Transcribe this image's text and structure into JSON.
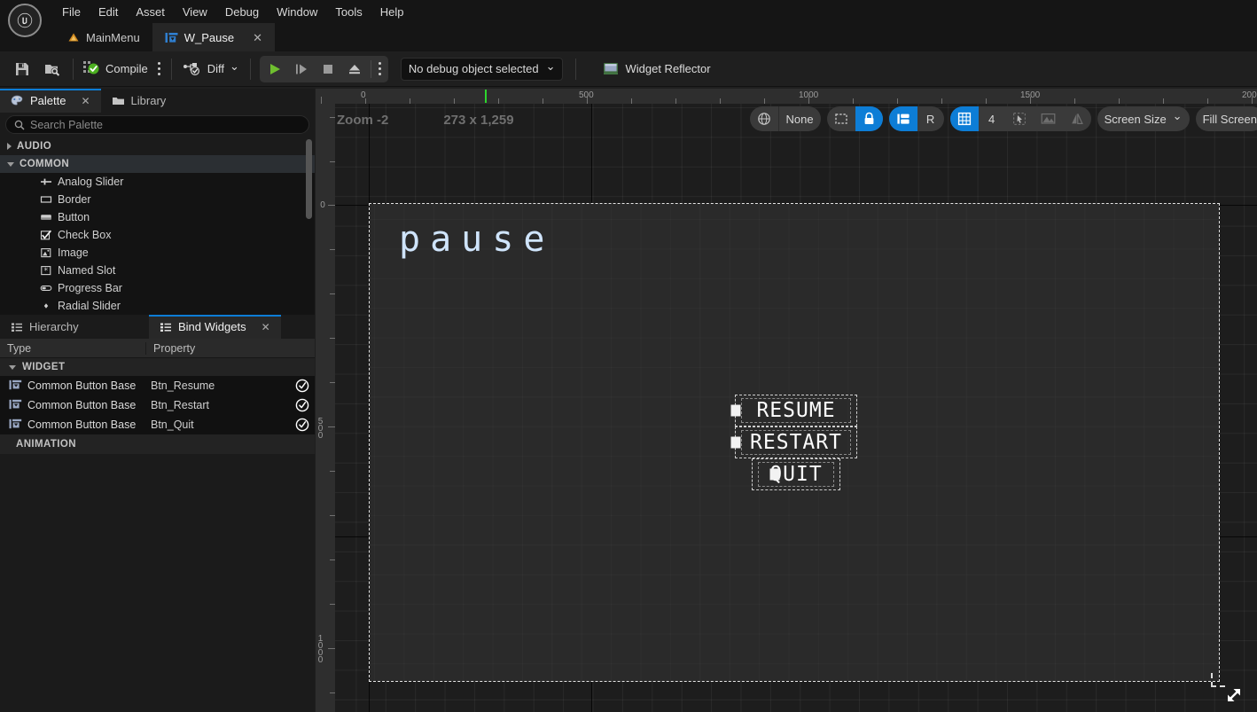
{
  "app": {
    "logo_glyph": "U"
  },
  "menu": {
    "items": [
      {
        "label": "File"
      },
      {
        "label": "Edit"
      },
      {
        "label": "Asset"
      },
      {
        "label": "View"
      },
      {
        "label": "Debug"
      },
      {
        "label": "Window"
      },
      {
        "label": "Tools"
      },
      {
        "label": "Help"
      }
    ]
  },
  "tabs": {
    "items": [
      {
        "label": "MainMenu",
        "icon": "blueprint-icon",
        "active": false,
        "closable": false
      },
      {
        "label": "W_Pause",
        "icon": "widget-blueprint-icon",
        "active": true,
        "closable": true,
        "close": "✕"
      }
    ]
  },
  "toolbar": {
    "save_icon": "save-icon",
    "browse_icon": "browse-content-icon",
    "compile_label": "Compile",
    "compile_icon": "compile-icon",
    "compile_kebab": "compile-options-icon",
    "diff_label": "Diff",
    "diff_icon": "diff-icon",
    "diff_caret": "⌄",
    "play_icon": "play-icon",
    "step_icon": "step-icon",
    "stop_icon": "stop-icon",
    "eject_icon": "eject-icon",
    "play_kebab": "play-options-icon",
    "debug_object": "No debug object selected",
    "debug_caret": "⌄",
    "widget_reflector_label": "Widget Reflector",
    "widget_reflector_icon": "widget-reflector-icon"
  },
  "palette": {
    "tabs": [
      {
        "label": "Palette",
        "icon": "palette-icon",
        "active": true,
        "close": "✕"
      },
      {
        "label": "Library",
        "icon": "library-folder-icon",
        "active": false
      }
    ],
    "search": {
      "placeholder": "Search Palette",
      "value": "",
      "icon": "search-icon"
    },
    "categories": [
      {
        "label": "AUDIO",
        "expanded": false
      },
      {
        "label": "COMMON",
        "expanded": true
      }
    ],
    "items": [
      {
        "label": "Analog Slider",
        "icon": "analog-slider-icon"
      },
      {
        "label": "Border",
        "icon": "border-icon"
      },
      {
        "label": "Button",
        "icon": "button-icon"
      },
      {
        "label": "Check Box",
        "icon": "check-box-icon"
      },
      {
        "label": "Image",
        "icon": "image-icon"
      },
      {
        "label": "Named Slot",
        "icon": "named-slot-icon"
      },
      {
        "label": "Progress Bar",
        "icon": "progress-bar-icon"
      },
      {
        "label": "Radial Slider",
        "icon": "radial-slider-icon"
      }
    ]
  },
  "bind_widgets": {
    "tabs": [
      {
        "label": "Hierarchy",
        "icon": "hierarchy-icon",
        "active": false
      },
      {
        "label": "Bind Widgets",
        "icon": "bind-widgets-icon",
        "active": true,
        "close": "✕"
      }
    ],
    "columns": [
      {
        "label": "Type"
      },
      {
        "label": "Property"
      },
      {
        "label": ""
      }
    ],
    "group_widget": "WIDGET",
    "group_animation": "ANIMATION",
    "rows": [
      {
        "type": "Common Button Base",
        "property": "Btn_Resume",
        "icon": "common-button-base-icon",
        "status": "bound-check-icon"
      },
      {
        "type": "Common Button Base",
        "property": "Btn_Restart",
        "icon": "common-button-base-icon",
        "status": "bound-check-icon"
      },
      {
        "type": "Common Button Base",
        "property": "Btn_Quit",
        "icon": "common-button-base-icon",
        "status": "bound-check-icon"
      }
    ]
  },
  "designer": {
    "zoom_label": "Zoom -2",
    "size_label": "273 x 1,259",
    "ruler_h": {
      "labels": [
        "0",
        "500",
        "1000",
        "1500",
        "200"
      ],
      "positions": [
        416,
        667,
        916,
        1166,
        1410
      ]
    },
    "ruler_v": {
      "labels": [
        "0",
        "500",
        "1000"
      ],
      "positions": [
        231,
        482,
        731
      ]
    },
    "tools": {
      "locale_icon": "globe-icon",
      "locale_label": "None",
      "selection_icon": "selection-outline-icon",
      "lock_icon": "lock-icon",
      "dock_icon": "dock-panel-icon",
      "rotate_label": "R",
      "grid_icon": "grid-snap-icon",
      "grid_value": "4",
      "pointer_icon": "pointer-snap-icon",
      "image_icon": "image-snap-icon",
      "mirror_icon": "mirror-icon",
      "screen_size_label": "Screen Size",
      "screen_size_caret": "⌄",
      "fill_screen_label": "Fill Screen",
      "resize_icon": "resize-diagonal-icon"
    },
    "widget_preview": {
      "title": "Pause",
      "buttons": [
        {
          "label": "RESUME",
          "narrow": false
        },
        {
          "label": "RESTART",
          "narrow": false
        },
        {
          "label": "QUIT",
          "narrow": true
        }
      ]
    }
  },
  "colors": {
    "accent_blue": "#0d7dd6",
    "play_green": "#6fbf2f",
    "title_blue": "#cfe4fb",
    "panel_bg": "#1b1b1b",
    "canvas_bg": "#2a2a2a"
  }
}
